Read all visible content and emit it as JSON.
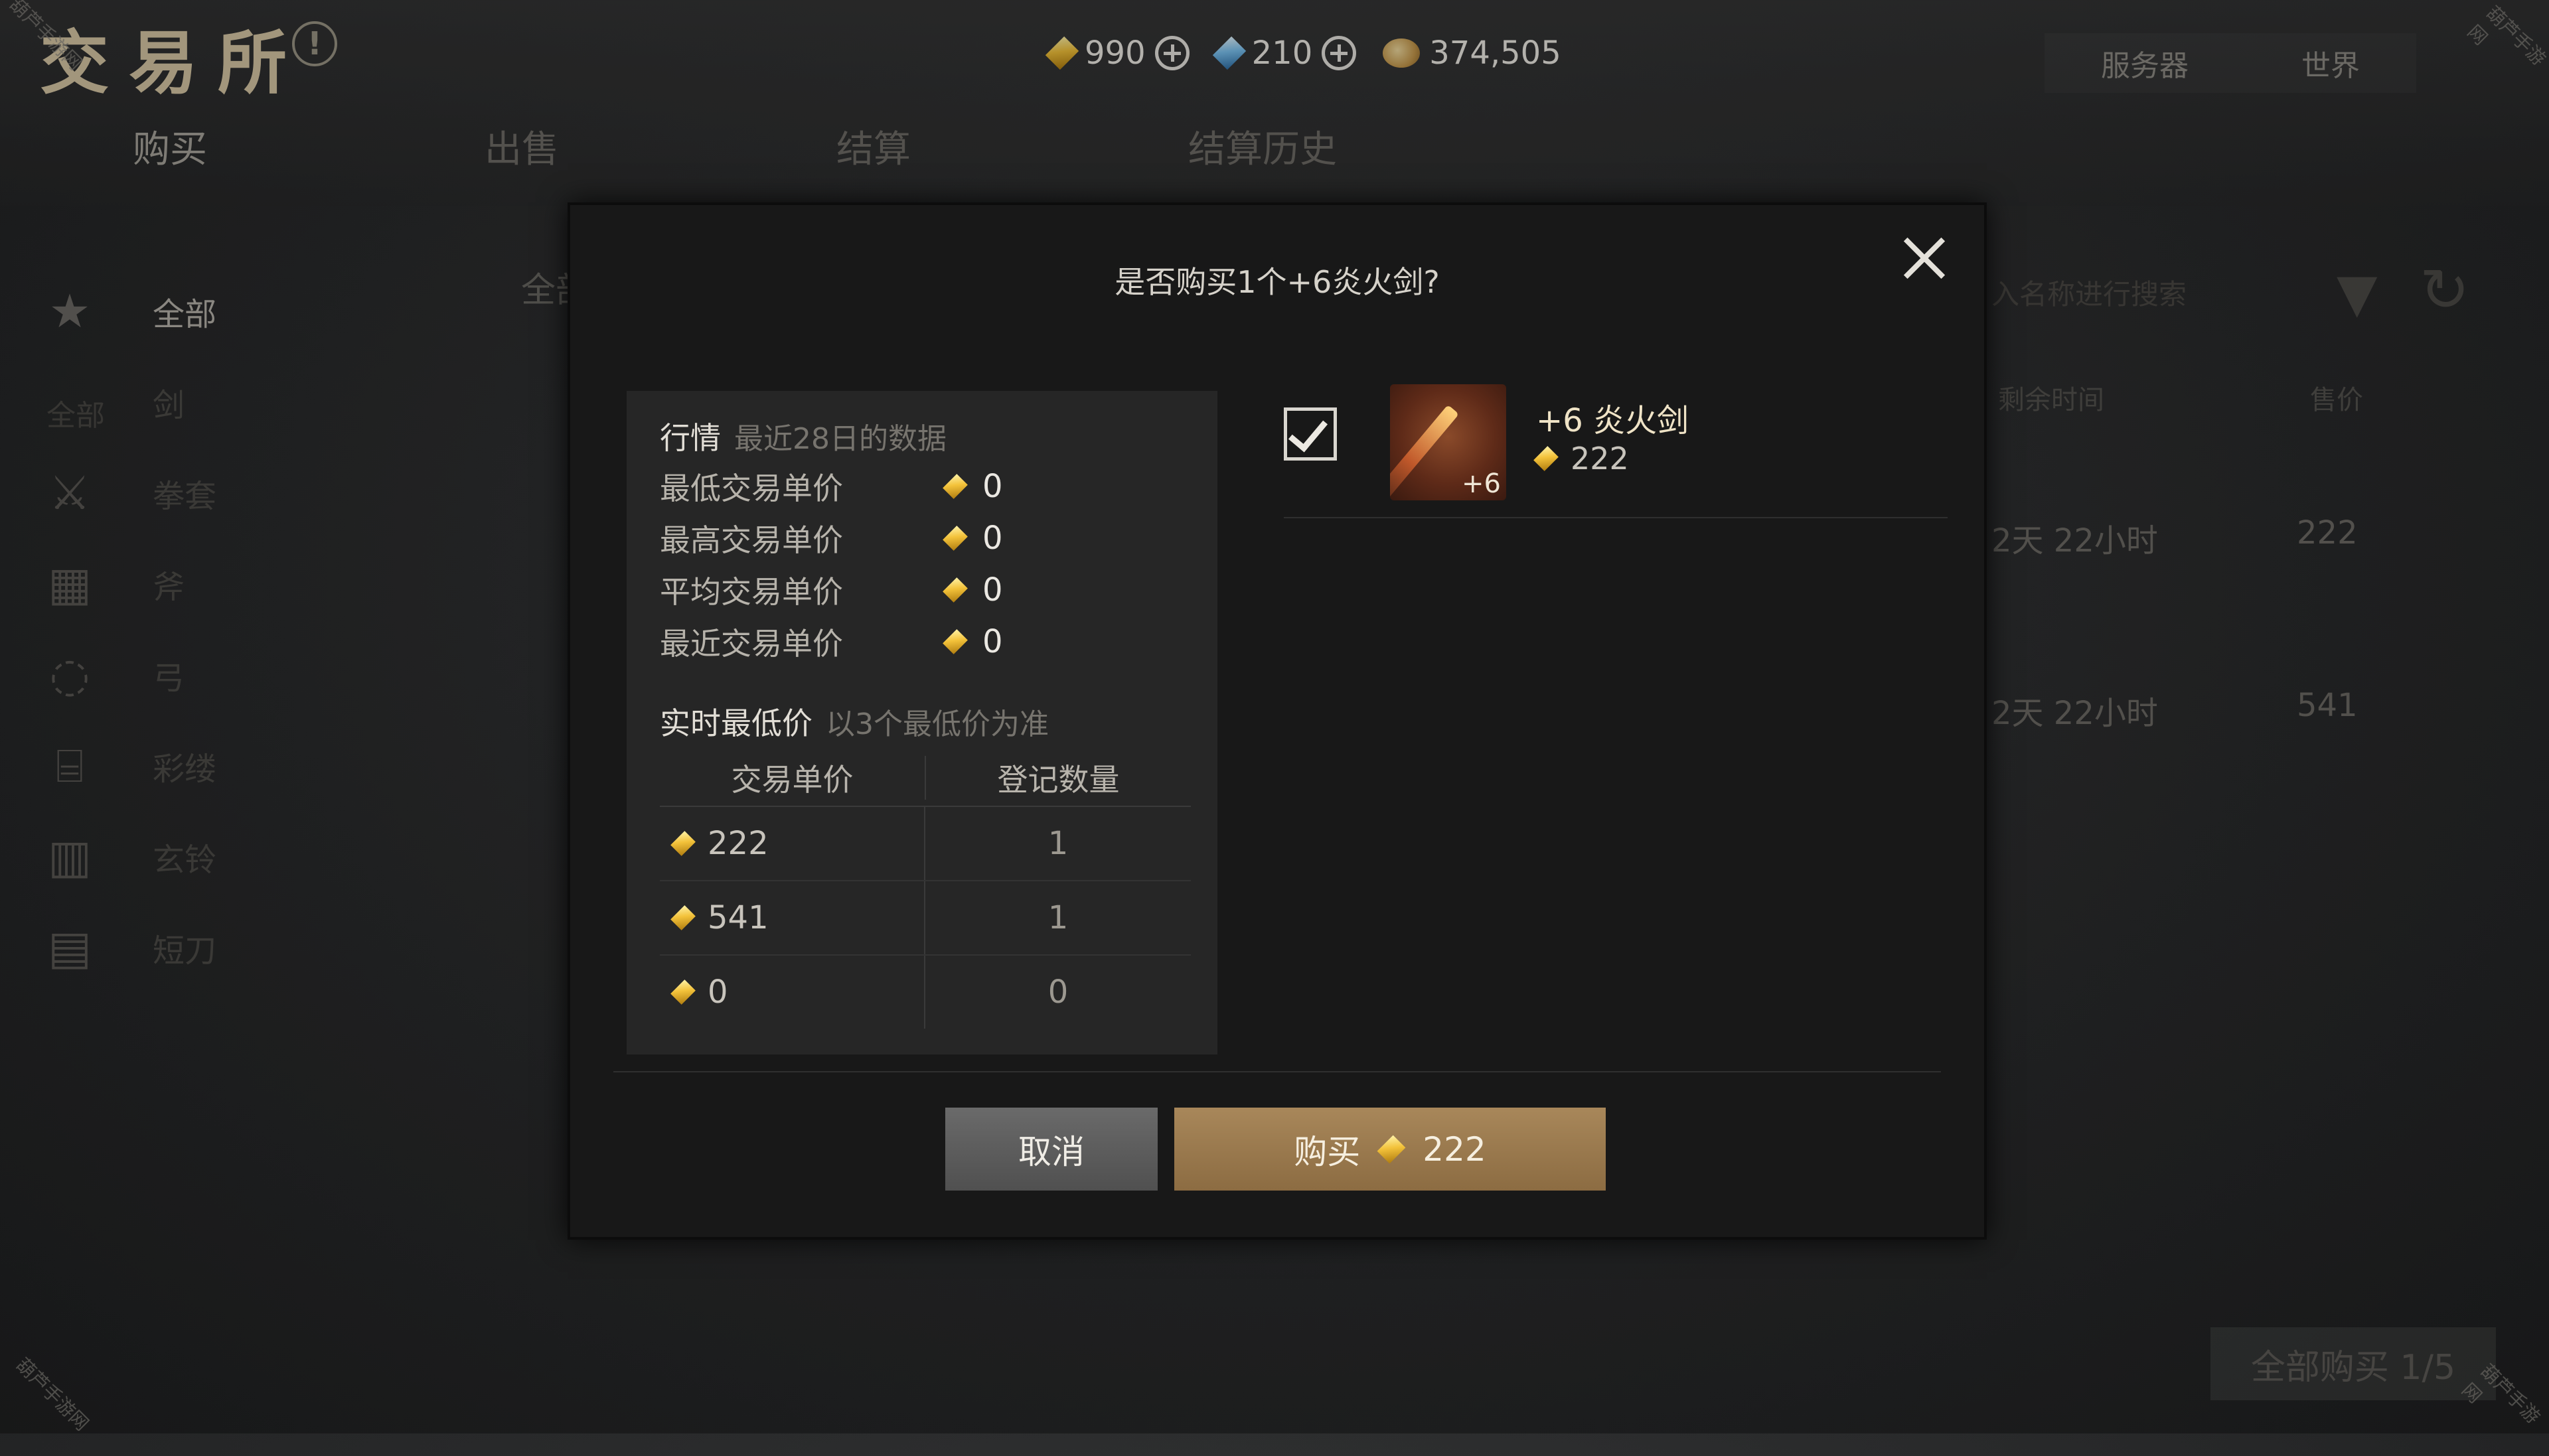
{
  "header": {
    "title": "交易所",
    "currencies": [
      {
        "icon": "gold-diamond-icon",
        "value": "990"
      },
      {
        "icon": "blue-diamond-icon",
        "value": "210"
      },
      {
        "icon": "coins-icon",
        "value": "374,505"
      }
    ],
    "server_tabs": [
      "服务器",
      "世界"
    ],
    "main_tabs": [
      "购买",
      "出售",
      "结算",
      "结算历史"
    ]
  },
  "sidebar": {
    "all_icon_label": "全部",
    "items": [
      "全部",
      "剑",
      "拳套",
      "斧",
      "弓",
      "彩缕",
      "玄铃",
      "短刀"
    ]
  },
  "background_list": {
    "category_label": "全部",
    "search_placeholder": "入名称进行搜索",
    "col_time": "剩余时间",
    "col_price": "售价",
    "rows": [
      {
        "time": "2天 22小时",
        "price": "222"
      },
      {
        "time": "2天 22小时",
        "price": "541"
      }
    ],
    "buy_all": "全部购买 1/5"
  },
  "modal": {
    "title": "是否购买1个+6炎火剑?",
    "market": {
      "heading": "行情",
      "heading_sub": "最近28日的数据",
      "stats": [
        {
          "label": "最低交易单价",
          "value": "0"
        },
        {
          "label": "最高交易单价",
          "value": "0"
        },
        {
          "label": "平均交易单价",
          "value": "0"
        },
        {
          "label": "最近交易单价",
          "value": "0"
        }
      ],
      "realtime_heading": "实时最低价",
      "realtime_sub": "以3个最低价为准",
      "table_headers": [
        "交易单价",
        "登记数量"
      ],
      "table_rows": [
        {
          "price": "222",
          "qty": "1"
        },
        {
          "price": "541",
          "qty": "1"
        },
        {
          "price": "0",
          "qty": "0"
        }
      ]
    },
    "item": {
      "name": "+6 炎火剑",
      "enhance": "+6",
      "price": "222",
      "checked": true
    },
    "cancel_label": "取消",
    "buy_label": "购买",
    "buy_price": "222"
  },
  "watermark": "葫芦手游网",
  "colors": {
    "accent_gold": "#f3c23a",
    "buy_button": "#9a7a4e",
    "cancel_button": "#5c5c5c"
  }
}
